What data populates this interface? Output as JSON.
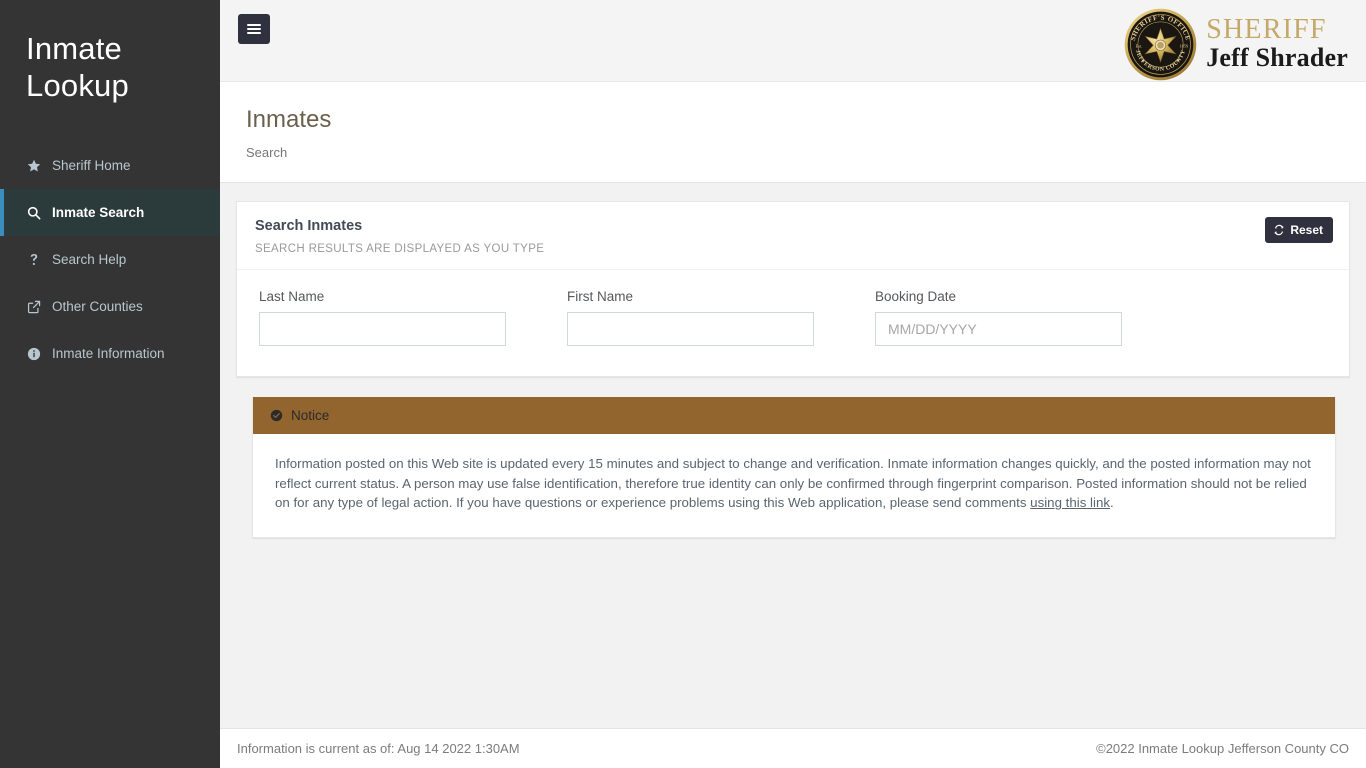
{
  "sidebar": {
    "brand_line1": "Inmate",
    "brand_line2": "Lookup",
    "items": [
      {
        "label": "Sheriff Home",
        "icon": "star-icon",
        "active": false
      },
      {
        "label": "Inmate Search",
        "icon": "search-icon",
        "active": true
      },
      {
        "label": "Search Help",
        "icon": "question-mark-icon",
        "active": false
      },
      {
        "label": "Other Counties",
        "icon": "external-link-icon",
        "active": false
      },
      {
        "label": "Inmate Information",
        "icon": "info-circle-icon",
        "active": false
      }
    ]
  },
  "topbar": {
    "menu_toggle_label": "Toggle navigation",
    "logo": {
      "sheriff_word": "SHERIFF",
      "sheriff_name": "Jeff Shrader",
      "seal_top_text": "SHERIFF'S OFFICE",
      "seal_bottom_text": "JEFFERSON COUNTY",
      "seal_est_left": "Est.",
      "seal_est_right": "1859"
    }
  },
  "content_header": {
    "page_title": "Inmates",
    "breadcrumb": "Search"
  },
  "search_panel": {
    "title": "Search Inmates",
    "subtitle": "SEARCH RESULTS ARE DISPLAYED AS YOU TYPE",
    "reset_label": "Reset",
    "reset_icon": "refresh-icon",
    "fields": [
      {
        "label": "Last Name",
        "value": "",
        "placeholder": ""
      },
      {
        "label": "First Name",
        "value": "",
        "placeholder": ""
      },
      {
        "label": "Booking Date",
        "value": "",
        "placeholder": "MM/DD/YYYY"
      }
    ]
  },
  "notice": {
    "header_label": "Notice",
    "header_icon": "check-circle-icon",
    "body_text_before_link": "Information posted on this Web site is updated every 15 minutes and subject to change and verification. Inmate information changes quickly, and the posted information may not reflect current status. A person may use false identification, therefore true identity can only be confirmed through fingerprint comparison. Posted information should not be relied on for any type of legal action. If you have questions or experience problems using this Web application, please send comments ",
    "link_text": "using this link",
    "body_text_after_link": "."
  },
  "footer": {
    "left": "Information is current as of: Aug 14 2022 1:30AM",
    "right": "©2022 Inmate Lookup Jefferson County CO"
  },
  "colors": {
    "sidebar_bg": "#343434",
    "sidebar_active_bg": "#2b3a3a",
    "sidebar_active_accent": "#3c8dbc",
    "notice_header_bg": "#92642e",
    "page_title": "#6b5f4e",
    "logo_gold": "#c4a96a",
    "content_bg": "#f2f2f2",
    "button_dark": "#2f323e"
  }
}
